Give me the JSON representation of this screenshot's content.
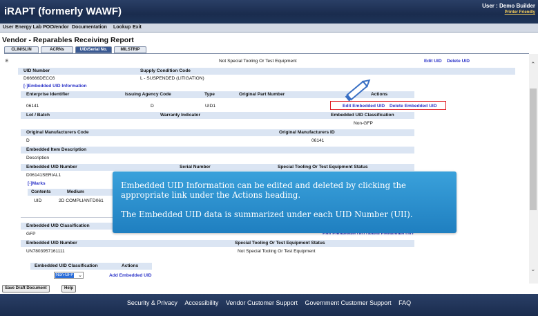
{
  "header": {
    "app_title": "iRAPT (formerly WAWF)",
    "user_label": "User : Demo Builder",
    "printer_friendly": "Printer Friendly"
  },
  "menu": [
    "User",
    "Energy Lab POC",
    "Vendor",
    "Documentation",
    "Lookup",
    "Exit"
  ],
  "page_title": "Vendor - Reparables Receiving Report",
  "tabs": [
    "CLIN/SLIN",
    "ACRNs",
    "UID/Serial No.",
    "MILSTRIP"
  ],
  "top_row": {
    "marker": "E",
    "status": "Not Special Tooling Or Test Equipment",
    "edit_uid": "Edit UID",
    "delete_uid": "Delete UID"
  },
  "uid_block": {
    "uid_number_label": "UID Number",
    "supply_condition_label": "Supply Condition Code",
    "uid_number": "D66666DECC6",
    "supply_condition": "L - SUSPENDED (LITIGATION)",
    "embedded_toggle": "[-]Embedded UID Information"
  },
  "embedded": {
    "enterprise_id_label": "Enterprise Identifier",
    "issuing_agency_label": "Issuing Agency Code",
    "type_label": "Type",
    "orig_part_label": "Original Part Number",
    "actions_label": "Actions",
    "enterprise_id": "06141",
    "issuing_agency": "D",
    "type": "UID1",
    "edit_embedded": "Edit Embedded UID",
    "delete_embedded": "Delete Embedded UID",
    "lot_label": "Lot / Batch",
    "warranty_label": "Warranty Indicator",
    "classification_label": "Embedded UID Classification",
    "classification": "Non-GFP",
    "orig_mfr_code_label": "Original Manufacturers Code",
    "orig_mfr_id_label": "Original Manufacturers ID",
    "orig_mfr_code": "D",
    "orig_mfr_id": "06141",
    "item_desc_label": "Embedded Item Description",
    "item_desc": "Description",
    "emb_uid_number_label": "Embedded UID Number",
    "serial_label": "Serial Number",
    "special_tooling_label": "Special Tooling Or Test Equipment Status",
    "emb_uid_number": "D06141SERIAL1",
    "marks_toggle": "[-]Marks",
    "contents_label": "Contents",
    "medium_label": "Medium",
    "contents": "UID",
    "medium": "2D COMPLIANT",
    "mark_value": "D061"
  },
  "second": {
    "classification_label": "Embedded UID Classification",
    "classification": "GFP",
    "partial_links": "Edit Embedded UID  Delete Embedded UID",
    "uid_number_label": "Embedded UID Number",
    "special_label": "Special Tooling Or Test Equipment Status",
    "uid_number": "UN7803957161111",
    "special_value": "Not Special Tooling Or Test Equipment",
    "class_col_label": "Embedded UID Classification",
    "actions_col_label": "Actions",
    "select_value": "Non-GFP",
    "add_link": "Add Embedded UID"
  },
  "buttons": {
    "save_draft": "Save Draft Document",
    "help": "Help"
  },
  "callout": {
    "line1": "Embedded UID Information can be edited and deleted by clicking the",
    "line2": "appropriate link under the Actions heading.",
    "line3": "The Embedded UID data is summarized under each UID Number (UII)."
  },
  "footer": [
    "Security & Privacy",
    "Accessibility",
    "Vendor Customer Support",
    "Government Customer Support",
    "FAQ"
  ],
  "colors": {
    "header": "#1a2c4e",
    "link": "#2b33c8",
    "callout": "#2a90cf",
    "highlight": "#e0191f"
  }
}
